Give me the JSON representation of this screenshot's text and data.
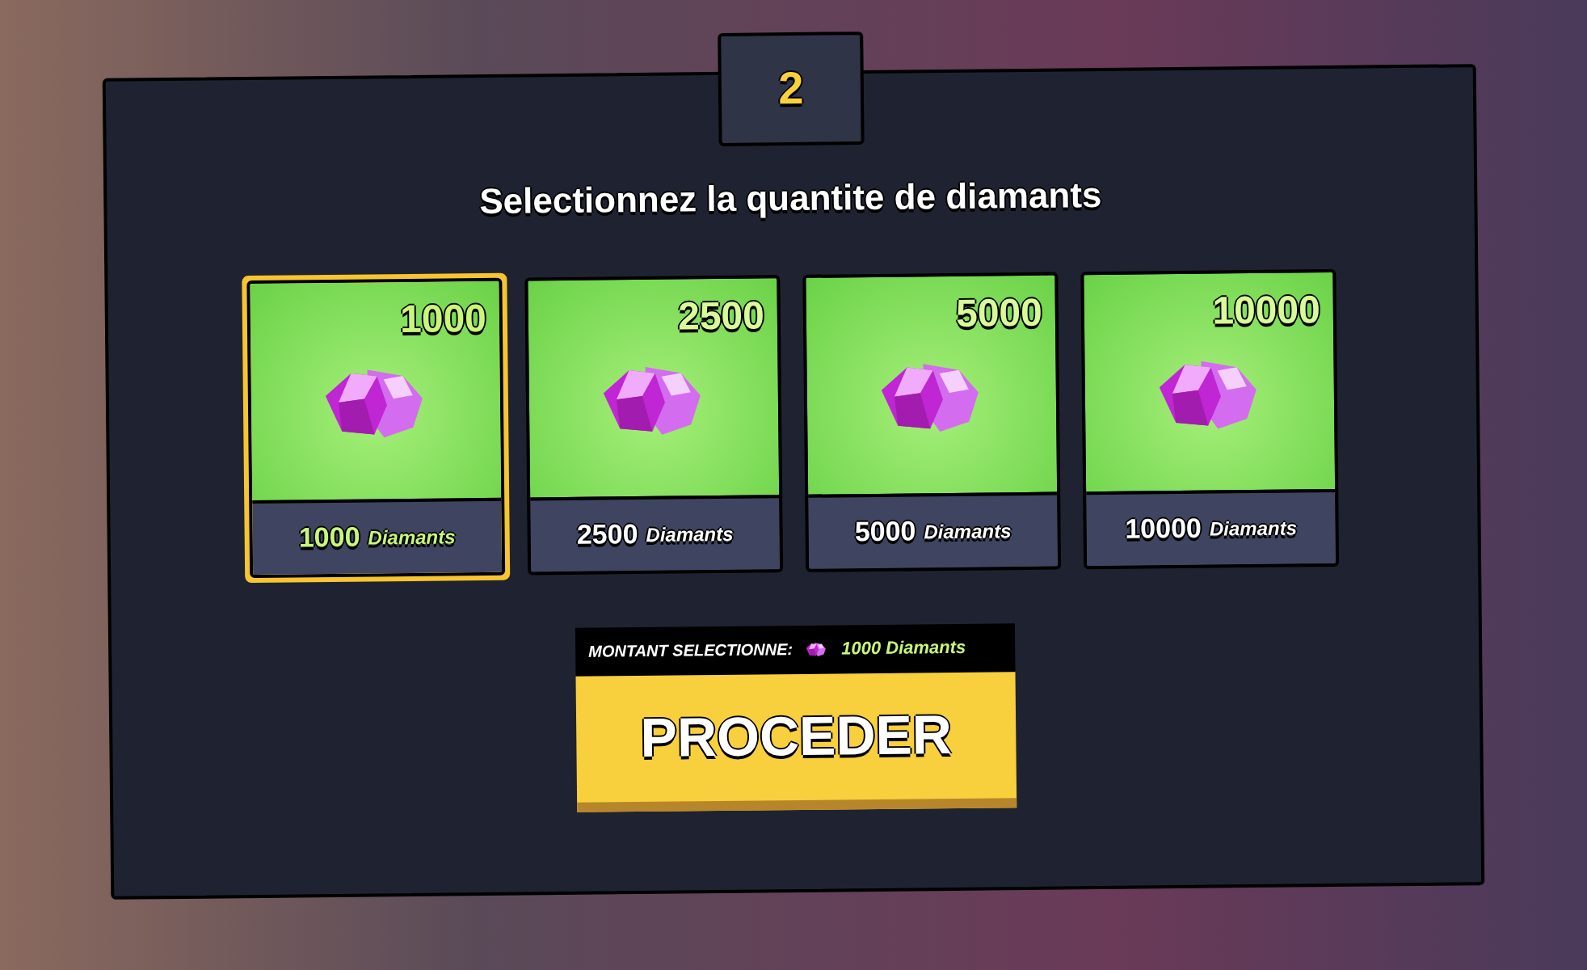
{
  "step": "2",
  "title": "Selectionnez la quantite de diamants",
  "packages": [
    {
      "amount": "1000",
      "caption_amount": "1000",
      "unit": "Diamants",
      "selected": true
    },
    {
      "amount": "2500",
      "caption_amount": "2500",
      "unit": "Diamants",
      "selected": false
    },
    {
      "amount": "5000",
      "caption_amount": "5000",
      "unit": "Diamants",
      "selected": false
    },
    {
      "amount": "10000",
      "caption_amount": "10000",
      "unit": "Diamants",
      "selected": false
    }
  ],
  "selection": {
    "label": "MONTANT SELECTIONNE:",
    "value": "1000 Diamants"
  },
  "button": "PROCEDER"
}
